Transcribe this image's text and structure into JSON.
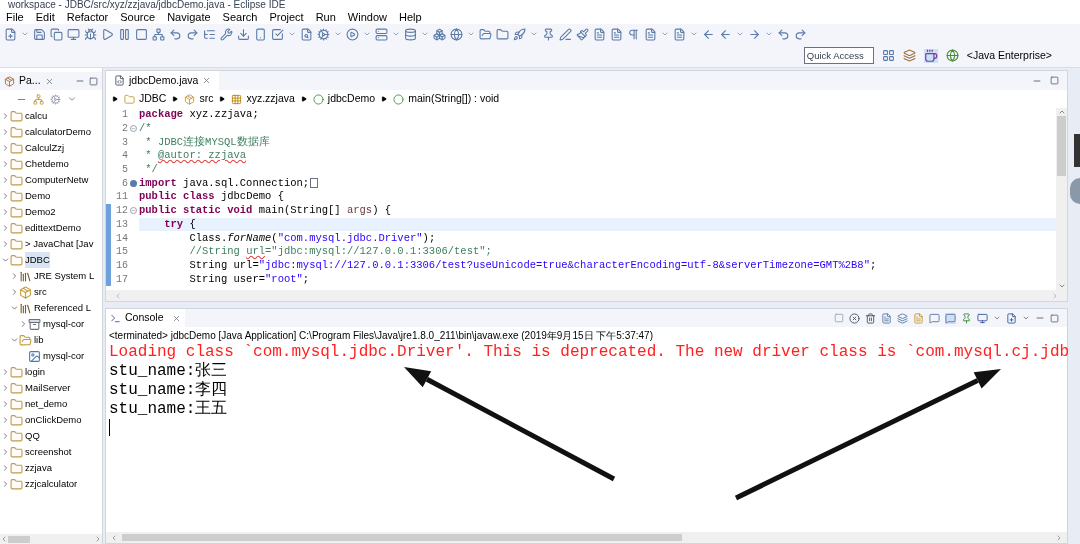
{
  "window": {
    "title": "workspace - JDBC/src/xyz/zzjava/jdbcDemo.java - Eclipse IDE"
  },
  "menu": [
    "File",
    "Edit",
    "Refactor",
    "Source",
    "Navigate",
    "Search",
    "Project",
    "Run",
    "Window",
    "Help"
  ],
  "quick_access": {
    "placeholder": "Quick Access"
  },
  "perspective": {
    "label": "<Java Enterprise>"
  },
  "package_explorer": {
    "tab": "Pa...",
    "items": [
      {
        "label": "calcu",
        "kind": "project",
        "expanded": false
      },
      {
        "label": "calculatorDemo",
        "kind": "project",
        "expanded": false
      },
      {
        "label": "CalculZzj",
        "kind": "project",
        "expanded": false
      },
      {
        "label": "Chetdemo",
        "kind": "project",
        "expanded": false
      },
      {
        "label": "ComputerNetw",
        "kind": "project",
        "expanded": false
      },
      {
        "label": "Demo",
        "kind": "project",
        "expanded": false
      },
      {
        "label": "Demo2",
        "kind": "project",
        "expanded": false
      },
      {
        "label": "edittextDemo",
        "kind": "project",
        "expanded": false
      },
      {
        "label": "> JavaChat [Jav",
        "kind": "project",
        "expanded": false
      },
      {
        "label": "JDBC",
        "kind": "project",
        "expanded": true,
        "selected": true,
        "children": [
          {
            "label": "JRE System L",
            "kind": "library",
            "expanded": false
          },
          {
            "label": "src",
            "kind": "source",
            "expanded": false
          },
          {
            "label": "Referenced L",
            "kind": "library",
            "expanded": true,
            "children": [
              {
                "label": "mysql-cor",
                "kind": "jar",
                "expanded": false
              }
            ]
          },
          {
            "label": "lib",
            "kind": "folder",
            "expanded": true,
            "children": [
              {
                "label": "mysql-cor",
                "kind": "file"
              }
            ]
          }
        ]
      },
      {
        "label": "login",
        "kind": "project",
        "expanded": false
      },
      {
        "label": "MailServer",
        "kind": "project",
        "expanded": false
      },
      {
        "label": "net_demo",
        "kind": "project",
        "expanded": false
      },
      {
        "label": "onClickDemo",
        "kind": "project",
        "expanded": false
      },
      {
        "label": "QQ",
        "kind": "project",
        "expanded": false
      },
      {
        "label": "screenshot",
        "kind": "project",
        "expanded": false
      },
      {
        "label": "zzjava",
        "kind": "project",
        "expanded": false
      },
      {
        "label": "zzjcalculator",
        "kind": "project",
        "expanded": false
      }
    ]
  },
  "editor": {
    "tab": "jdbcDemo.java",
    "breadcrumb": [
      {
        "label": "JDBC",
        "kind": "project"
      },
      {
        "label": "src",
        "kind": "source"
      },
      {
        "label": "xyz.zzjava",
        "kind": "package"
      },
      {
        "label": "jdbcDemo",
        "kind": "class"
      },
      {
        "label": "main(String[]) : void",
        "kind": "method"
      }
    ],
    "lines": [
      {
        "number": "1",
        "current": false,
        "changed": false,
        "tokens": [
          {
            "kind": "keyword",
            "text": "package"
          },
          {
            "kind": "plain",
            "text": " xyz.zzjava;"
          }
        ]
      },
      {
        "number": "2",
        "expanded": true,
        "current": false,
        "changed": false,
        "tokens": [
          {
            "kind": "comment",
            "text": "/*"
          }
        ]
      },
      {
        "number": "3",
        "current": false,
        "changed": false,
        "tokens": [
          {
            "kind": "comment",
            "text": " * JDBC连接MYSQL数据库"
          }
        ]
      },
      {
        "number": "4",
        "current": false,
        "changed": false,
        "tokens": [
          {
            "kind": "comment",
            "text": " * "
          },
          {
            "kind": "comment_flagged",
            "text": "@autor: zzjava"
          }
        ]
      },
      {
        "number": "5",
        "current": false,
        "changed": false,
        "tokens": [
          {
            "kind": "comment",
            "text": " */"
          }
        ]
      },
      {
        "number": "6",
        "expanded": false,
        "current": false,
        "changed": false,
        "tokens": [
          {
            "kind": "keyword",
            "text": "import"
          },
          {
            "kind": "plain",
            "text": " java.sql.Connection;"
          }
        ]
      },
      {
        "number": "11",
        "current": false,
        "changed": false,
        "tokens": [
          {
            "kind": "keyword",
            "text": "public class"
          },
          {
            "kind": "plain",
            "text": " jdbcDemo {"
          }
        ]
      },
      {
        "number": "12",
        "expanded": true,
        "current": false,
        "changed": true,
        "tokens": [
          {
            "kind": "keyword",
            "text": "public static void"
          },
          {
            "kind": "plain",
            "text": " main(String[] "
          },
          {
            "kind": "param",
            "text": "args"
          },
          {
            "kind": "plain",
            "text": ") {"
          }
        ]
      },
      {
        "number": "13",
        "current": true,
        "changed": true,
        "tokens": [
          {
            "kind": "keyword",
            "text": "    try"
          },
          {
            "kind": "plain",
            "text": " {"
          }
        ]
      },
      {
        "number": "14",
        "current": false,
        "changed": true,
        "tokens": [
          {
            "kind": "plain",
            "text": "        Class."
          },
          {
            "kind": "italic",
            "text": "forName"
          },
          {
            "kind": "plain",
            "text": "("
          },
          {
            "kind": "string",
            "text": "\"com.mysql.jdbc.Driver\""
          },
          {
            "kind": "plain",
            "text": ");"
          }
        ]
      },
      {
        "number": "15",
        "current": false,
        "changed": true,
        "tokens": [
          {
            "kind": "comment",
            "text": "        //String "
          },
          {
            "kind": "comment_flagged",
            "text": "url"
          },
          {
            "kind": "comment",
            "text": "=\"jdbc:mysql://127.0.0.1:3306/test\";"
          }
        ]
      },
      {
        "number": "16",
        "current": false,
        "changed": true,
        "tokens": [
          {
            "kind": "plain",
            "text": "        String url="
          },
          {
            "kind": "string",
            "text": "\"jdbc:mysql://127.0.0.1:3306/test?useUnicode=true&characterEncoding=utf-8&serverTimezone=GMT%2B8\""
          },
          {
            "kind": "plain",
            "text": ";"
          }
        ]
      },
      {
        "number": "17",
        "current": false,
        "changed": true,
        "tokens": [
          {
            "kind": "plain",
            "text": "        String user="
          },
          {
            "kind": "string",
            "text": "\"root\""
          },
          {
            "kind": "plain",
            "text": ";"
          }
        ]
      }
    ]
  },
  "console": {
    "tab": "Console",
    "status": "<terminated> jdbcDemo [Java Application] C:\\Program Files\\Java\\jre1.8.0_211\\bin\\javaw.exe (2019年9月15日 下午5:37:47)",
    "lines": [
      {
        "kind": "error",
        "text": "Loading class `com.mysql.jdbc.Driver'. This is deprecated. The new driver class is `com.mysql.cj.jdb"
      },
      {
        "kind": "output",
        "text": "stu_name:张三"
      },
      {
        "kind": "output",
        "text": "stu_name:李四"
      },
      {
        "kind": "output",
        "text": "stu_name:王五"
      }
    ]
  }
}
